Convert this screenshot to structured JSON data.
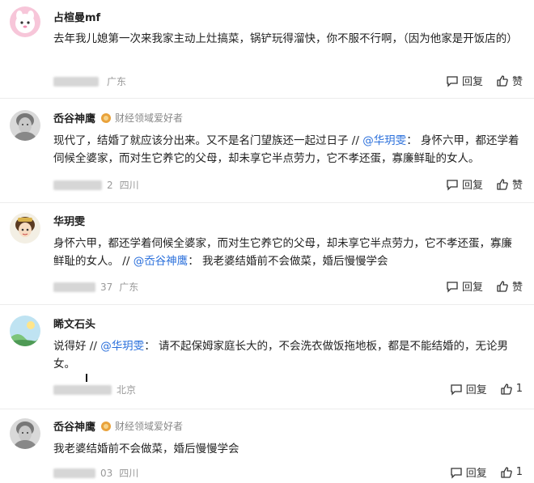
{
  "actions": {
    "reply_label": "回复",
    "like_label": "赞"
  },
  "comments": [
    {
      "username": "占楦曼mf",
      "badge": "",
      "text_plain": "去年我儿媳第一次来我家主动上灶搞菜，锅铲玩得溜快，你不服不行啊，（因为他家是开饭店的）",
      "location": "广东",
      "time_suffix": "",
      "like_count": ""
    },
    {
      "username": "岙谷神鹰",
      "badge": "财经领域爱好者",
      "text_before": "现代了，结婚了就应该分出来。又不是名门望族还一起过日子 // ",
      "mention": "@华玥雯",
      "text_after": "：  身怀六甲，都还学着伺候全婆家，而对生它养它的父母，却未享它半点劳力，它不孝还蛋，寡廉鲜耻的女人。",
      "location": "四川",
      "time_suffix": "2",
      "like_count": ""
    },
    {
      "username": "华玥雯",
      "badge": "",
      "text_before": "身怀六甲，都还学着伺候全婆家，而对生它养它的父母，却未享它半点劳力，它不孝还蛋，寡廉鲜耻的女人。 // ",
      "mention": "@岙谷神鹰",
      "text_after": "：  我老婆结婚前不会做菜，婚后慢慢学会",
      "location": "广东",
      "time_suffix": "37",
      "like_count": ""
    },
    {
      "username": "睎文石头",
      "badge": "",
      "text_before": "说得好 // ",
      "mention": "@华玥雯",
      "text_after": "：  请不起保姆家庭长大的，不会洗衣做饭拖地板，都是不能结婚的，无论男女。",
      "location": "北京",
      "time_suffix": "",
      "like_count": "1"
    },
    {
      "username": "岙谷神鹰",
      "badge": "财经领域爱好者",
      "text_plain": "我老婆结婚前不会做菜，婚后慢慢学会",
      "location": "四川",
      "time_suffix": "03",
      "like_count": "1"
    }
  ]
}
